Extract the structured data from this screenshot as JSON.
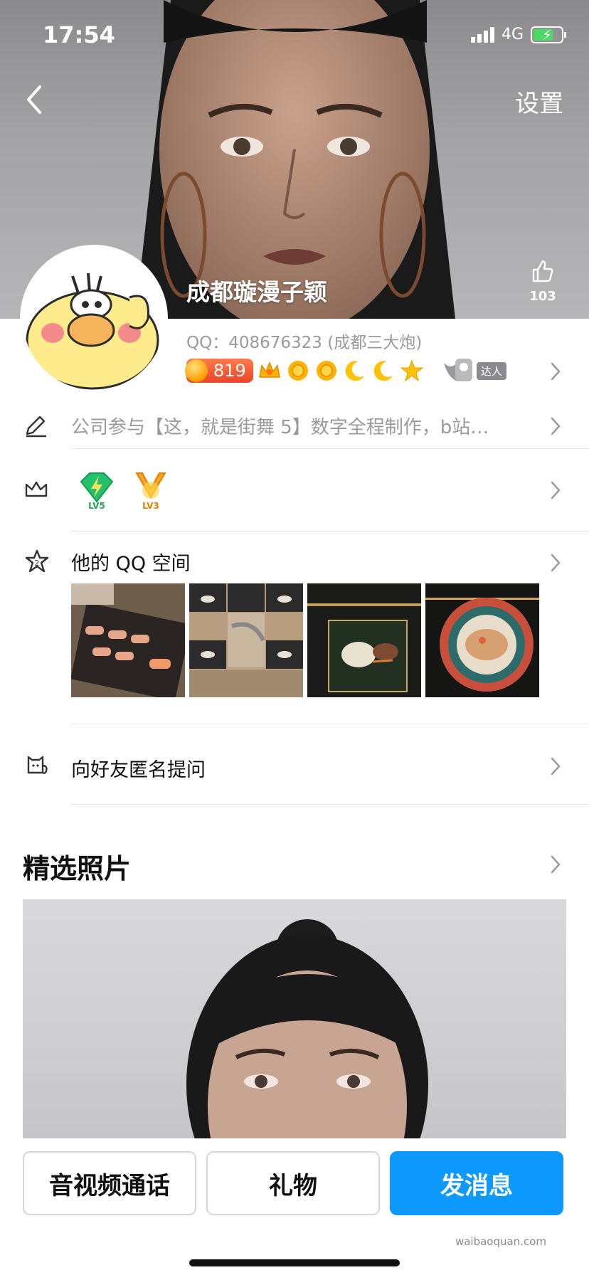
{
  "status_bar": {
    "time": "17:54",
    "network": "4G"
  },
  "header": {
    "settings_label": "设置",
    "nickname": "成都璇漫子颖",
    "like_count": "103"
  },
  "profile": {
    "qq_line": "QQ：408676323 (成都三大炮)",
    "coin_level": "819",
    "daren_label": "达人"
  },
  "signature": {
    "text": "公司参与【这，就是街舞 5】数字全程制作，b站…"
  },
  "vip": {
    "badge1_label": "LV5",
    "badge2_label": "LV3"
  },
  "qzone": {
    "title": "他的 QQ 空间",
    "zone_icon_number": "2"
  },
  "ask": {
    "label": "向好友匿名提问"
  },
  "featured": {
    "title": "精选照片"
  },
  "actions": {
    "call": "音视频通话",
    "gift": "礼物",
    "message": "发消息"
  },
  "watermark": "waibaoquan.com",
  "colors": {
    "primary": "#0d99ff",
    "coin": "#e9452a",
    "vip_green": "#23c16b",
    "vip_orange": "#ffa423"
  },
  "icons": {
    "back": "chevron-left-icon",
    "like": "thumbs-up-icon",
    "edit": "pencil-icon",
    "crown": "crown-icon",
    "zone": "star-icon",
    "ask": "cat-icon",
    "chevron": "chevron-right-icon"
  }
}
